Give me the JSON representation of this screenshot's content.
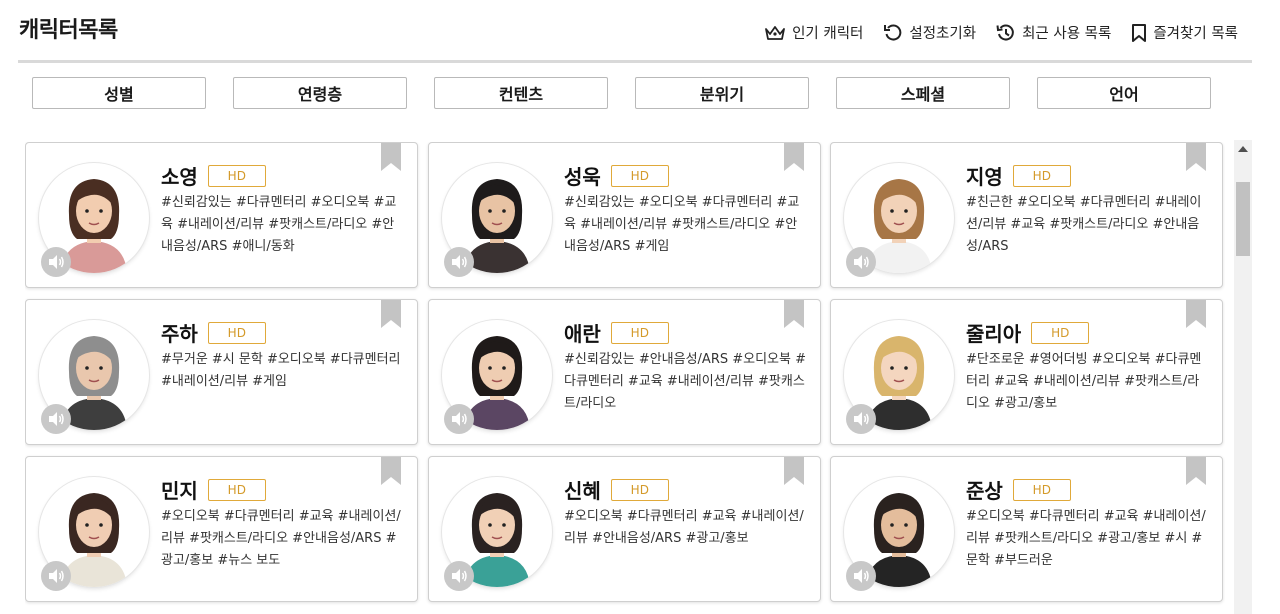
{
  "header": {
    "title": "캐릭터목록",
    "actions": [
      {
        "label": "인기 캐릭터",
        "icon": "crown-icon"
      },
      {
        "label": "설정초기화",
        "icon": "reset-icon"
      },
      {
        "label": "최근 사용 목록",
        "icon": "history-icon"
      },
      {
        "label": "즐겨찾기 목록",
        "icon": "bookmark-icon"
      }
    ]
  },
  "filters": [
    "성별",
    "연령층",
    "컨텐츠",
    "분위기",
    "스페셜",
    "언어"
  ],
  "badge_label": "HD",
  "colors": {
    "accent": "#d49a2a",
    "bookmark": "#c4c4c4",
    "speaker": "#c8c8c8"
  },
  "characters": [
    {
      "name": "소영",
      "tags": "#신뢰감있는 #다큐멘터리 #오디오북 #교육 #내레이션/리뷰 #팟캐스트/라디오 #안내음성/ARS #애니/동화"
    },
    {
      "name": "성욱",
      "tags": "#신뢰감있는 #오디오북 #다큐멘터리 #교육 #내레이션/리뷰 #팟캐스트/라디오 #안내음성/ARS #게임"
    },
    {
      "name": "지영",
      "tags": "#친근한 #오디오북 #다큐멘터리 #내레이션/리뷰 #교육 #팟캐스트/라디오 #안내음성/ARS"
    },
    {
      "name": "주하",
      "tags": "#무거운 #시 문학 #오디오북 #다큐멘터리 #내레이션/리뷰 #게임"
    },
    {
      "name": "애란",
      "tags": "#신뢰감있는 #안내음성/ARS #오디오북 #다큐멘터리 #교육 #내레이션/리뷰 #팟캐스트/라디오"
    },
    {
      "name": "줄리아",
      "tags": "#단조로운 #영어더빙 #오디오북 #다큐멘터리 #교육 #내레이션/리뷰 #팟캐스트/라디오 #광고/홍보"
    },
    {
      "name": "민지",
      "tags": "#오디오북 #다큐멘터리 #교육 #내레이션/리뷰 #팟캐스트/라디오 #안내음성/ARS #광고/홍보 #뉴스 보도"
    },
    {
      "name": "신혜",
      "tags": "#오디오북 #다큐멘터리 #교육 #내레이션/리뷰 #안내음성/ARS #광고/홍보"
    },
    {
      "name": "준상",
      "tags": "#오디오북 #다큐멘터리 #교육 #내레이션/리뷰 #팟캐스트/라디오 #광고/홍보 #시 #문학 #부드러운"
    }
  ]
}
